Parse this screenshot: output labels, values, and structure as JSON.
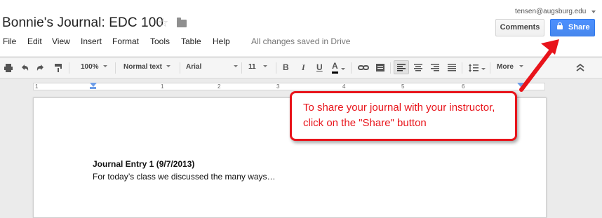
{
  "document": {
    "title": "Bonnie's Journal: EDC 100",
    "status": "All changes saved in Drive"
  },
  "account": {
    "email": "tensen@augsburg.edu"
  },
  "header_buttons": {
    "comments": "Comments",
    "share": "Share"
  },
  "menu": [
    "File",
    "Edit",
    "View",
    "Insert",
    "Format",
    "Tools",
    "Table",
    "Help"
  ],
  "toolbar": {
    "zoom": "100%",
    "style": "Normal text",
    "font": "Arial",
    "size": "11",
    "bold": "B",
    "italic": "I",
    "underline": "U",
    "text_color": "A",
    "more": "More",
    "icons": [
      "print-icon",
      "undo-icon",
      "redo-icon",
      "paint-format-icon",
      "link-icon",
      "comment-icon",
      "align-left-icon",
      "align-center-icon",
      "align-right-icon",
      "justify-icon",
      "line-spacing-icon",
      "collapse-icon"
    ]
  },
  "ruler": {
    "numbers": [
      "1",
      "1",
      "2",
      "3",
      "4",
      "5",
      "6"
    ]
  },
  "page": {
    "entry_title": "Journal Entry 1 (9/7/2013)",
    "entry_body": "For today’s class we discussed the many ways…"
  },
  "annotation": {
    "text": "To share your journal with your instructor, click on the \"Share\" button",
    "color": "#e8141b"
  },
  "colors": {
    "share_button": "#4d90fe",
    "annotation": "#e8141b"
  }
}
